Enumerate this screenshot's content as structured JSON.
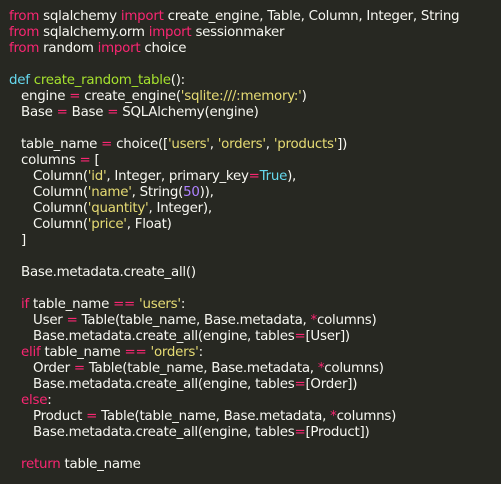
{
  "editor": {
    "theme": {
      "background": "#272822",
      "foreground": "#f8f8f2",
      "keyword": "#f92672",
      "operator": "#f92672",
      "function_name": "#a6e22e",
      "def_keyword": "#66d9ef",
      "string": "#e6db74",
      "number": "#ae81ff"
    },
    "lines": [
      [
        [
          "kw",
          "from"
        ],
        [
          "plain",
          " sqlalchemy "
        ],
        [
          "kw",
          "import"
        ],
        [
          "plain",
          " create_engine, Table, Column, Integer, String"
        ]
      ],
      [
        [
          "kw",
          "from"
        ],
        [
          "plain",
          " sqlalchemy.orm "
        ],
        [
          "kw",
          "import"
        ],
        [
          "plain",
          " sessionmaker"
        ]
      ],
      [
        [
          "kw",
          "from"
        ],
        [
          "plain",
          " random "
        ],
        [
          "kw",
          "import"
        ],
        [
          "plain",
          " choice"
        ]
      ],
      [],
      [
        [
          "def",
          "def"
        ],
        [
          "plain",
          " "
        ],
        [
          "fn",
          "create_random_table"
        ],
        [
          "plain",
          "():"
        ]
      ],
      [
        [
          "plain",
          "   engine "
        ],
        [
          "op",
          "="
        ],
        [
          "plain",
          " create_engine("
        ],
        [
          "str",
          "'sqlite:///:memory:'"
        ],
        [
          "plain",
          ")"
        ]
      ],
      [
        [
          "plain",
          "   Base "
        ],
        [
          "op",
          "="
        ],
        [
          "plain",
          " Base "
        ],
        [
          "op",
          "="
        ],
        [
          "plain",
          " SQLAlchemy(engine)"
        ]
      ],
      [],
      [
        [
          "plain",
          "   table_name "
        ],
        [
          "op",
          "="
        ],
        [
          "plain",
          " choice(["
        ],
        [
          "str",
          "'users'"
        ],
        [
          "plain",
          ", "
        ],
        [
          "str",
          "'orders'"
        ],
        [
          "plain",
          ", "
        ],
        [
          "str",
          "'products'"
        ],
        [
          "plain",
          "])"
        ]
      ],
      [
        [
          "plain",
          "   columns "
        ],
        [
          "op",
          "="
        ],
        [
          "plain",
          " ["
        ]
      ],
      [
        [
          "plain",
          "      Column("
        ],
        [
          "str",
          "'id'"
        ],
        [
          "plain",
          ", Integer, primary_key"
        ],
        [
          "op",
          "="
        ],
        [
          "def",
          "True"
        ],
        [
          "plain",
          "),"
        ]
      ],
      [
        [
          "plain",
          "      Column("
        ],
        [
          "str",
          "'name'"
        ],
        [
          "plain",
          ", String("
        ],
        [
          "num",
          "50"
        ],
        [
          "plain",
          ")),"
        ]
      ],
      [
        [
          "plain",
          "      Column("
        ],
        [
          "str",
          "'quantity'"
        ],
        [
          "plain",
          ", Integer),"
        ]
      ],
      [
        [
          "plain",
          "      Column("
        ],
        [
          "str",
          "'price'"
        ],
        [
          "plain",
          ", Float)"
        ]
      ],
      [
        [
          "plain",
          "   ]"
        ]
      ],
      [],
      [
        [
          "plain",
          "   Base.metadata.create_all()"
        ]
      ],
      [],
      [
        [
          "plain",
          "   "
        ],
        [
          "kw",
          "if"
        ],
        [
          "plain",
          " table_name "
        ],
        [
          "op",
          "=="
        ],
        [
          "plain",
          " "
        ],
        [
          "str",
          "'users'"
        ],
        [
          "plain",
          ":"
        ]
      ],
      [
        [
          "plain",
          "      User "
        ],
        [
          "op",
          "="
        ],
        [
          "plain",
          " Table(table_name, Base.metadata, "
        ],
        [
          "op",
          "*"
        ],
        [
          "plain",
          "columns)"
        ]
      ],
      [
        [
          "plain",
          "      Base.metadata.create_all(engine, tables"
        ],
        [
          "op",
          "="
        ],
        [
          "plain",
          "[User])"
        ]
      ],
      [
        [
          "plain",
          "   "
        ],
        [
          "kw",
          "elif"
        ],
        [
          "plain",
          " table_name "
        ],
        [
          "op",
          "=="
        ],
        [
          "plain",
          " "
        ],
        [
          "str",
          "'orders'"
        ],
        [
          "plain",
          ":"
        ]
      ],
      [
        [
          "plain",
          "      Order "
        ],
        [
          "op",
          "="
        ],
        [
          "plain",
          " Table(table_name, Base.metadata, "
        ],
        [
          "op",
          "*"
        ],
        [
          "plain",
          "columns)"
        ]
      ],
      [
        [
          "plain",
          "      Base.metadata.create_all(engine, tables"
        ],
        [
          "op",
          "="
        ],
        [
          "plain",
          "[Order])"
        ]
      ],
      [
        [
          "plain",
          "   "
        ],
        [
          "kw",
          "else"
        ],
        [
          "plain",
          ":"
        ]
      ],
      [
        [
          "plain",
          "      Product "
        ],
        [
          "op",
          "="
        ],
        [
          "plain",
          " Table(table_name, Base.metadata, "
        ],
        [
          "op",
          "*"
        ],
        [
          "plain",
          "columns)"
        ]
      ],
      [
        [
          "plain",
          "      Base.metadata.create_all(engine, tables"
        ],
        [
          "op",
          "="
        ],
        [
          "plain",
          "[Product])"
        ]
      ],
      [],
      [
        [
          "plain",
          "   "
        ],
        [
          "kw",
          "return"
        ],
        [
          "plain",
          " table_name"
        ]
      ]
    ]
  }
}
